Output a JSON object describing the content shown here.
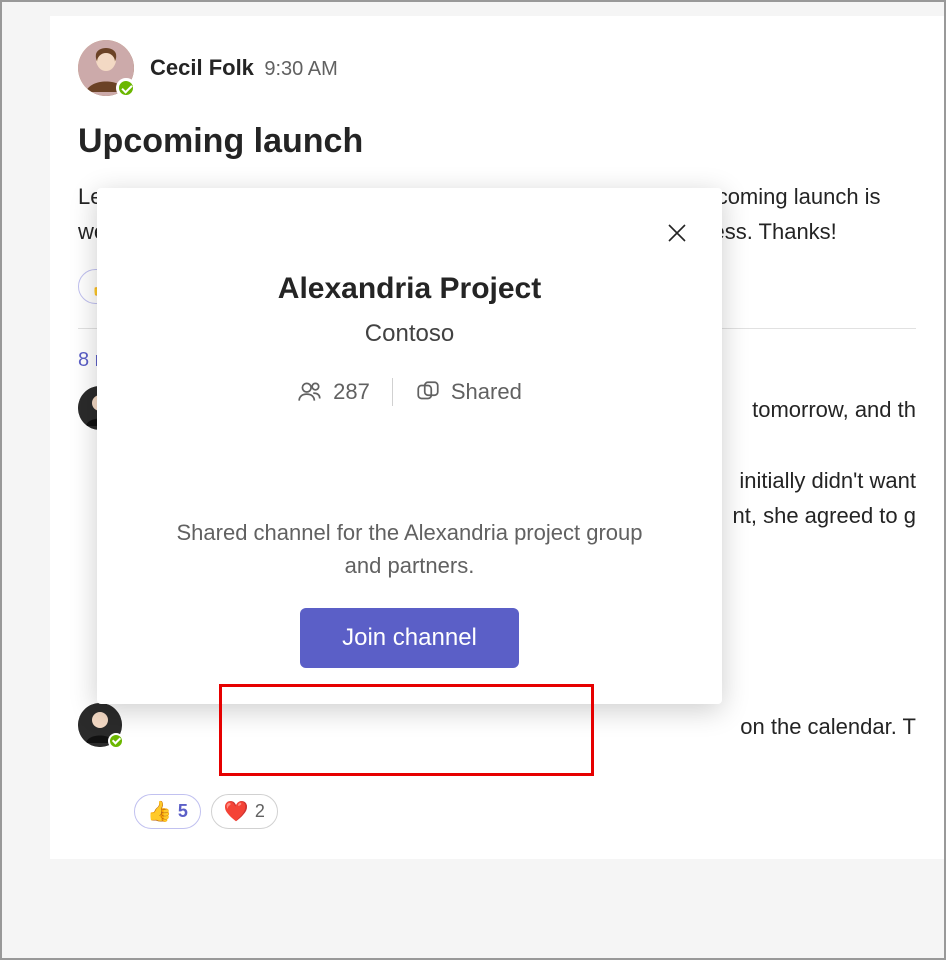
{
  "post": {
    "author": "Cecil Folk",
    "time": "9:30 AM",
    "subject": "Upcoming launch",
    "body": "Let's                                                                                               pcoming launch is\nwee                                                                                                ress. Thanks!",
    "reaction_emoji": "👍"
  },
  "replies": {
    "link": "8 rep",
    "items": [
      {
        "body": " tomorrow, and th\n\ninitially didn't want\nnt, she agreed to g"
      },
      {
        "body": " on the calendar. T"
      }
    ]
  },
  "reactions2": {
    "thumb_emoji": "👍",
    "thumb_count": "5",
    "heart_emoji": "❤️",
    "heart_count": "2"
  },
  "popover": {
    "title": "Alexandria Project",
    "team": "Contoso",
    "member_count": "287",
    "shared_label": "Shared",
    "description": "Shared channel for the Alexandria project group and partners.",
    "join_label": "Join channel"
  }
}
